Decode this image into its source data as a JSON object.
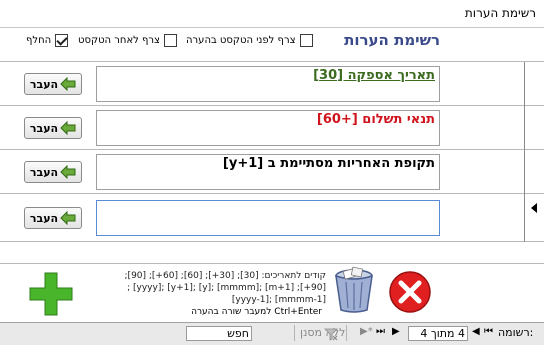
{
  "window": {
    "title": "רשימת הערות"
  },
  "header": {
    "title": "רשימת הערות",
    "options": [
      {
        "label": "צרף לפני הטקסט בהערה",
        "checked": false
      },
      {
        "label": "צרף לאחר הטקסט",
        "checked": false
      },
      {
        "label": "החלף",
        "checked": true
      }
    ]
  },
  "rows": [
    {
      "text": "תאריך אספקה [30]",
      "color": "#3b6b1e",
      "underline": true,
      "button": "העבר"
    },
    {
      "text": "תנאי תשלום [+60]",
      "color": "#d0141e",
      "underline": false,
      "button": "העבר"
    },
    {
      "text": "תקופת האחריות מסתיימת ב [y+1]",
      "color": "#000000",
      "underline": false,
      "button": "העבר"
    },
    {
      "text": "",
      "color": "#000000",
      "underline": false,
      "button": "העבר"
    }
  ],
  "footer": {
    "codes_text": "קודים לתאריכים: [30]; [30+]; [60]; [60+]; [90]; [90+]; [m+1] ;[mmmm] ;[y] ;[y+1] ;[yyyy] ;[mmmm-1] ;[yyyy-1]",
    "hint": "למעבר שורה בהערה Ctrl+Enter"
  },
  "navbar": {
    "record_label": "רשומה:",
    "record_value": "4 מתוך 4",
    "no_filter_label": "ללא מסנן",
    "search_label": "חפש"
  },
  "colors": {
    "header_title": "#3a4a8a",
    "add": "#49b52a",
    "delete": "#e02020"
  }
}
